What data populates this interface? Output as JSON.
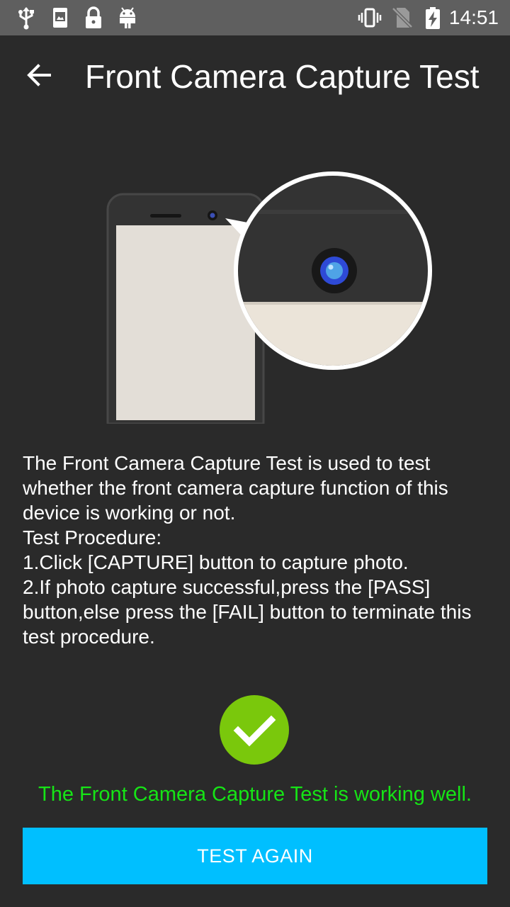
{
  "status_bar": {
    "time": "14:51",
    "left_icons": [
      "usb-icon",
      "screenshot-icon",
      "lock-icon",
      "android-icon"
    ],
    "right_icons": [
      "vibrate-icon",
      "no-sim-icon",
      "battery-charging-icon"
    ]
  },
  "app_bar": {
    "title": "Front Camera Capture Test",
    "back_icon": "arrow-back-icon"
  },
  "description": {
    "lines": [
      "The Front Camera Capture Test is used to test whether the front camera capture function of this device is working or not.",
      "Test Procedure:",
      "1.Click [CAPTURE] button to capture photo.",
      "2.If photo capture successful,press the [PASS] button,else press the [FAIL] button to terminate this test procedure."
    ]
  },
  "result": {
    "icon": "check-circle-icon",
    "message": "The Front Camera Capture Test is working well.",
    "color": "#16e416"
  },
  "action": {
    "label": "TEST AGAIN",
    "color": "#00bfff"
  }
}
